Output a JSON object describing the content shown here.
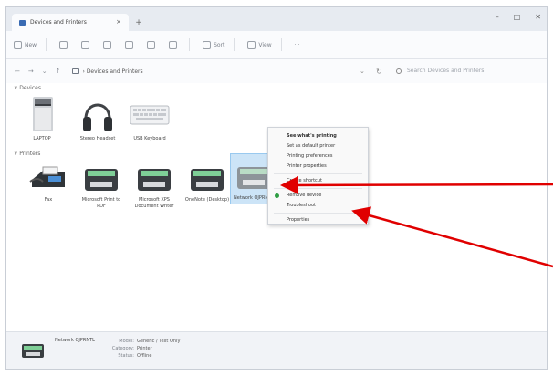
{
  "window": {
    "tab_title": "Devices and Printers",
    "tab_close": "×",
    "new_tab": "+",
    "controls": {
      "minimize": "–",
      "maximize": "□",
      "close": "✕"
    }
  },
  "toolbar": {
    "new_label": "New",
    "sort_label": "Sort",
    "view_label": "View",
    "more_label": "···"
  },
  "address": {
    "back": "←",
    "forward": "→",
    "up": "↑",
    "path": "Devices and Printers",
    "dropdown": "⌄",
    "refresh": "↻",
    "search_placeholder": "Search Devices and Printers"
  },
  "sections": {
    "devices": "∨ Devices",
    "printers": "∨ Printers"
  },
  "devices": [
    {
      "label": "LAPTOP",
      "icon": "computer-tower-icon"
    },
    {
      "label": "Stereo Headset",
      "icon": "headphones-icon"
    },
    {
      "label": "USB Keyboard",
      "icon": "keyboard-icon"
    }
  ],
  "printers": [
    {
      "label": "Fax",
      "icon": "fax-icon"
    },
    {
      "label": "Microsoft Print to PDF",
      "icon": "printer-icon"
    },
    {
      "label": "Microsoft XPS Document Writer",
      "icon": "printer-icon"
    },
    {
      "label": "OneNote (Desktop)",
      "icon": "printer-icon"
    },
    {
      "label": "Network OJPRNTL",
      "icon": "printer-icon",
      "selected": true
    }
  ],
  "context_menu": [
    {
      "label": "See what's printing",
      "bold": true
    },
    {
      "label": "Set as default printer"
    },
    {
      "label": "Printing preferences"
    },
    {
      "label": "Printer properties"
    },
    {
      "sep": true
    },
    {
      "label": "Create shortcut"
    },
    {
      "sep": true
    },
    {
      "label": "Remove device",
      "icon": "remove-shield-icon"
    },
    {
      "label": "Troubleshoot"
    },
    {
      "sep": true
    },
    {
      "label": "Properties"
    }
  ],
  "details": {
    "name": "Network OJPRNTL",
    "model_key": "Model:",
    "model_val": "Generic / Text Only",
    "category_key": "Category:",
    "category_val": "Printer",
    "status_key": "Status:",
    "status_val": "Offline"
  },
  "colors": {
    "accent_arrow": "#e00000",
    "selection": "#cce4f7"
  }
}
